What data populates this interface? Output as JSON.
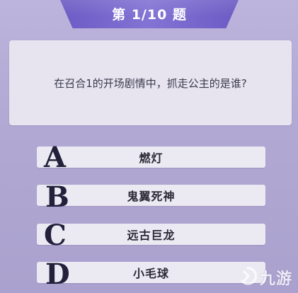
{
  "header": {
    "title": "第 1/10 题"
  },
  "question": {
    "text": "在召合1的开场剧情中，抓走公主的是谁?"
  },
  "options": [
    {
      "letter": "A",
      "text": "燃灯"
    },
    {
      "letter": "B",
      "text": "鬼翼死神"
    },
    {
      "letter": "C",
      "text": "远古巨龙"
    },
    {
      "letter": "D",
      "text": "小毛球"
    }
  ],
  "watermark": {
    "logo_icon": "jiuyou-logo-icon",
    "text": "九游"
  },
  "colors": {
    "background": "#b3aad3",
    "header": "#7564cb",
    "card": "#e7e4f0",
    "letter": "#22203a"
  }
}
